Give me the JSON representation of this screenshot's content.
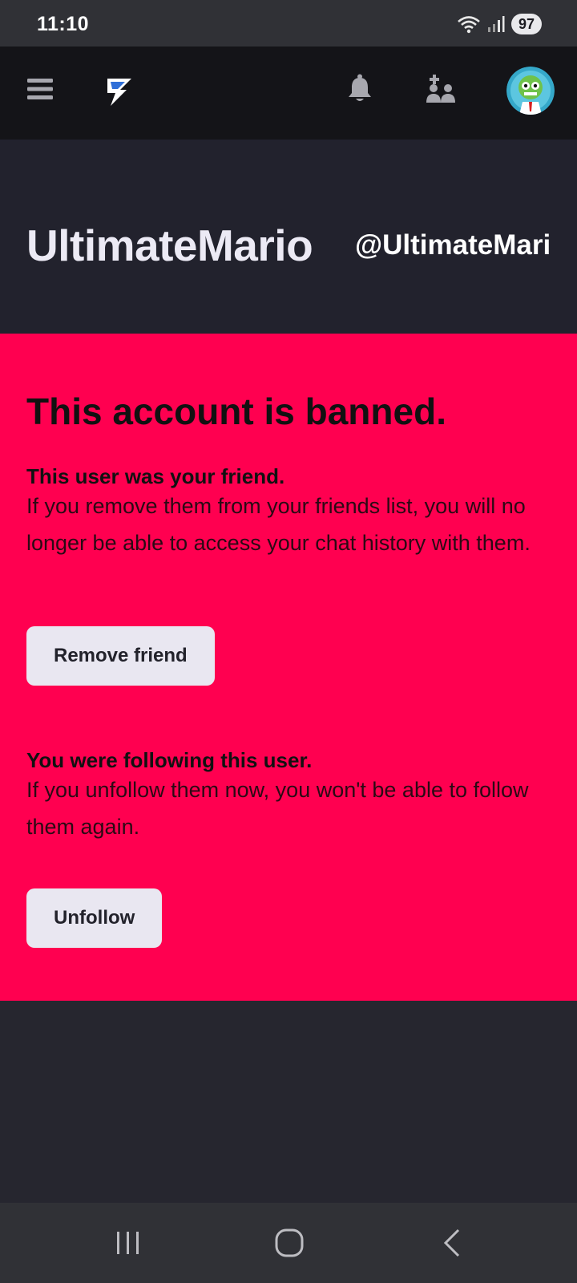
{
  "status_bar": {
    "time": "11:10",
    "battery": "97"
  },
  "header": {
    "icons": [
      "menu-icon",
      "lightning-logo-icon",
      "bell-icon",
      "add-friend-icon",
      "avatar"
    ]
  },
  "profile": {
    "display_name": "UltimateMario",
    "handle": "@UltimateMari"
  },
  "banned": {
    "title": "This account is banned.",
    "friend_section": {
      "title": "This user was your friend.",
      "body": "If you remove them from your friends list, you will no longer be able to access your chat history with them.",
      "button": "Remove friend"
    },
    "follow_section": {
      "title": "You were following this user.",
      "body": "If you unfollow them now, you won't be able to follow them again.",
      "button": "Unfollow"
    },
    "panel_color": "#ff0050"
  },
  "nav_bar": {
    "icons": [
      "recents-icon",
      "home-icon",
      "back-icon"
    ]
  }
}
